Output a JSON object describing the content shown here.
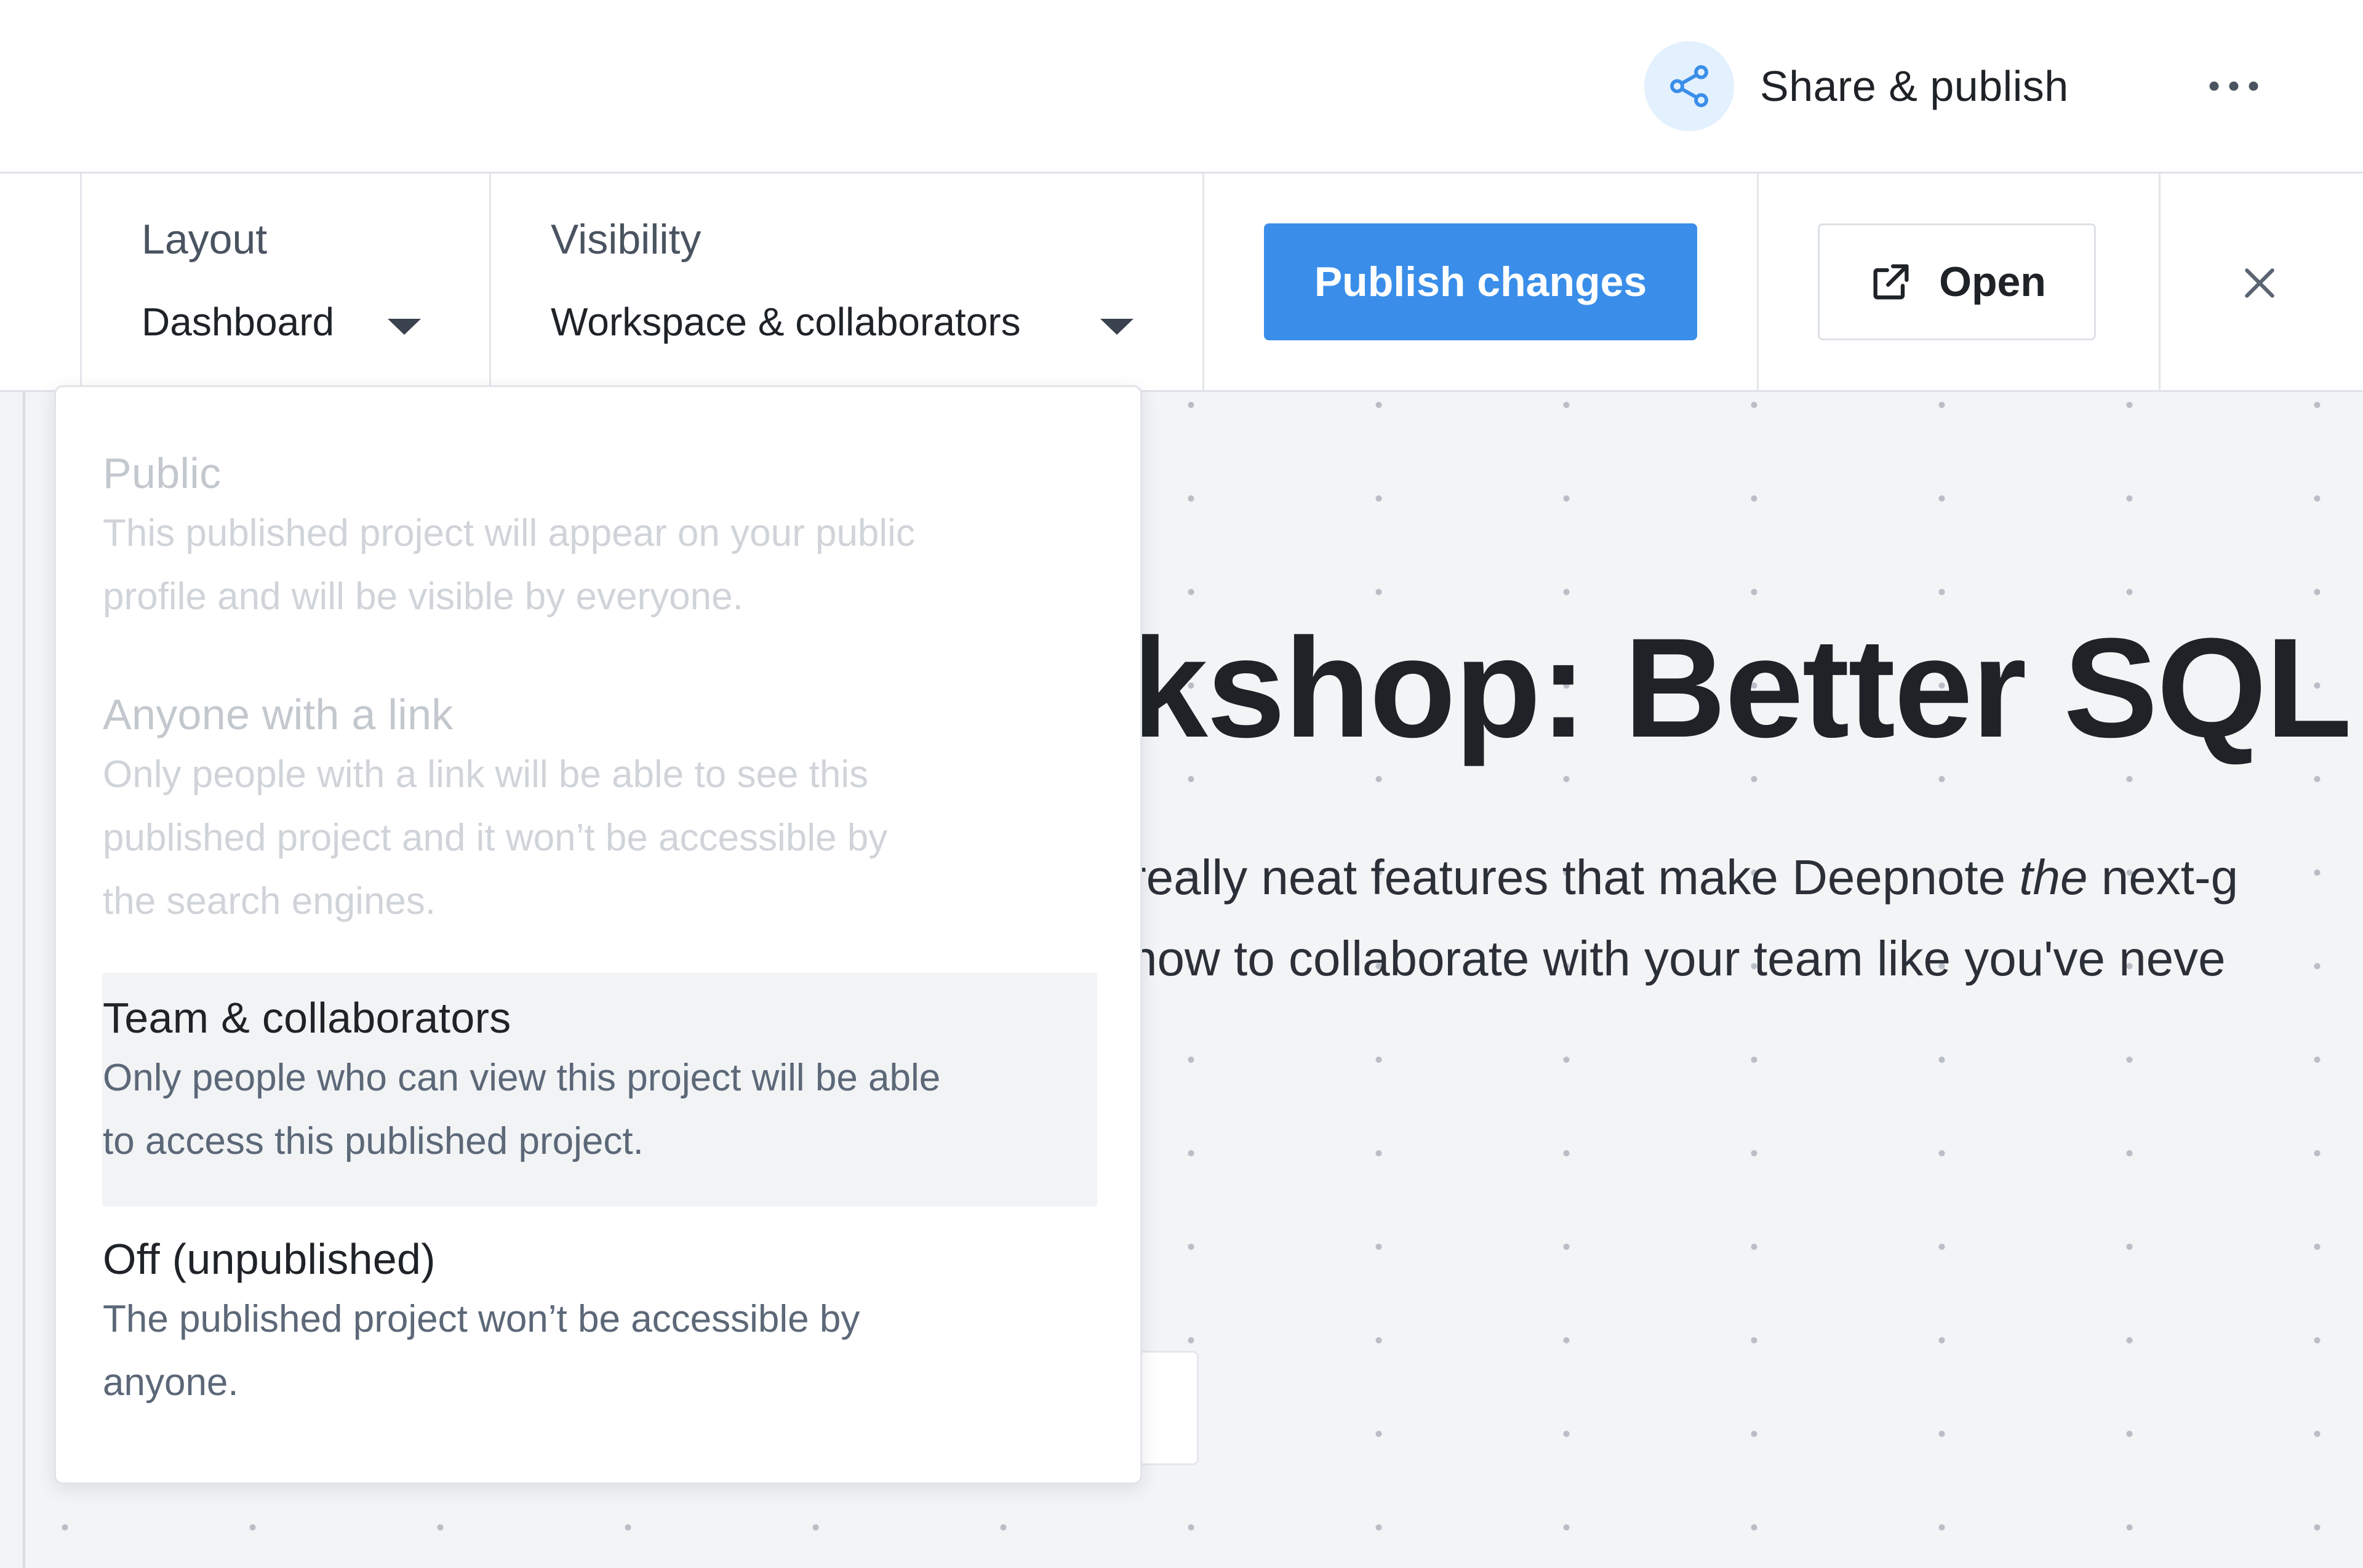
{
  "header": {
    "share_label": "Share & publish",
    "share_icon": "share-icon",
    "more_icon": "more-horizontal-icon",
    "accent_color": "#3a8ee9"
  },
  "toolbar": {
    "layout": {
      "label": "Layout",
      "value": "Dashboard"
    },
    "visibility": {
      "label": "Visibility",
      "value": "Workspace & collaborators"
    },
    "publish_label": "Publish changes",
    "open_label": "Open",
    "open_icon": "external-link-icon",
    "close_icon": "close-icon"
  },
  "document": {
    "title_fragment": "kshop: Better SQL",
    "line1_before": "really neat features that make Deepnote ",
    "line1_em": "the",
    "line1_after": " next-g",
    "line2": " how to collaborate with your team like you've neve"
  },
  "visibility_menu": {
    "options": [
      {
        "title": "Public",
        "desc_lines": [
          "This published project will appear on your public",
          "profile and will be visible by everyone."
        ],
        "state": "disabled"
      },
      {
        "title": "Anyone with a link",
        "desc_lines": [
          "Only people with a link will be able to see this",
          "published project and it won’t be accessible by",
          "the search engines."
        ],
        "state": "disabled"
      },
      {
        "title": "Team & collaborators",
        "desc_lines": [
          "Only people who can view this project will be able",
          "to access this published project."
        ],
        "state": "highlighted"
      },
      {
        "title": "Off (unpublished)",
        "desc_lines": [
          "The published project won’t be accessible by",
          "anyone."
        ],
        "state": "normal"
      }
    ]
  }
}
